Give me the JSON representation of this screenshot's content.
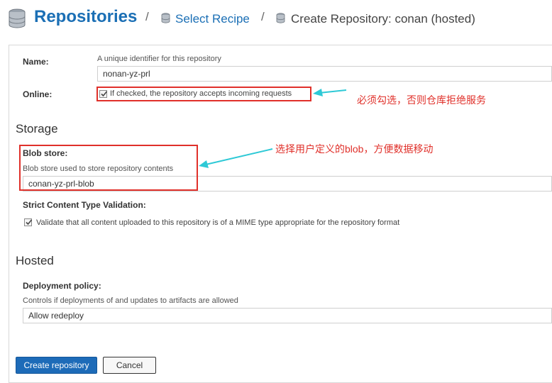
{
  "header": {
    "title": "Repositories",
    "separator": "/",
    "crumb_select": "Select Recipe",
    "crumb_current": "Create Repository: conan (hosted)"
  },
  "form": {
    "name_label": "Name:",
    "name_help": "A unique identifier for this repository",
    "name_value": "nonan-yz-prl",
    "online_label": "Online:",
    "online_checkbox_label": "If checked, the repository accepts incoming requests",
    "online_checked": true,
    "storage_title": "Storage",
    "blob_label": "Blob store:",
    "blob_help": "Blob store used to store repository contents",
    "blob_value": "conan-yz-prl-blob",
    "strict_label": "Strict Content Type Validation:",
    "strict_checkbox_label": "Validate that all content uploaded to this repository is of a MIME type appropriate for the repository format",
    "strict_checked": true,
    "hosted_title": "Hosted",
    "deploy_label": "Deployment policy:",
    "deploy_help": "Controls if deployments of and updates to artifacts are allowed",
    "deploy_value": "Allow redeploy"
  },
  "buttons": {
    "create": "Create repository",
    "cancel": "Cancel"
  },
  "annotations": {
    "online_note": "必须勾选，否则仓库拒绝服务",
    "blob_note": "选择用户定义的blob，方便数据移动"
  },
  "colors": {
    "brand_blue": "#1b6fb5",
    "annotation_red": "#e0302a",
    "arrow_cyan": "#2ec9d6"
  }
}
